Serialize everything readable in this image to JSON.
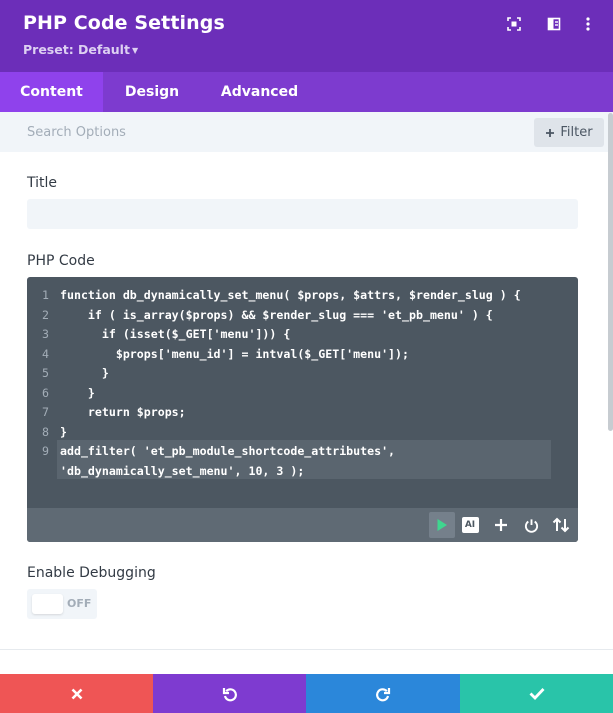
{
  "header": {
    "title": "PHP Code Settings",
    "preset": "Preset: Default",
    "icons": [
      "expand-icon",
      "split-view-icon",
      "more-options-icon"
    ],
    "background": "#6c2eb9"
  },
  "tabs": [
    {
      "label": "Content",
      "active": true
    },
    {
      "label": "Design",
      "active": false
    },
    {
      "label": "Advanced",
      "active": false
    }
  ],
  "search": {
    "placeholder": "Search Options",
    "value": "",
    "filter_label": "Filter"
  },
  "fields": {
    "title_label": "Title",
    "title_value": "",
    "code_label": "PHP Code",
    "debug_label": "Enable Debugging",
    "debug_state": "OFF"
  },
  "code": {
    "line_numbers": [
      "1",
      "2",
      "3",
      "4",
      "5",
      "6",
      "7",
      "8",
      "9"
    ],
    "lines": [
      "function db_dynamically_set_menu( $props, $attrs, $render_slug ) {",
      "    if ( is_array($props) && $render_slug === 'et_pb_menu' ) {",
      "      if (isset($_GET['menu'])) {",
      "        $props['menu_id'] = intval($_GET['menu']);",
      "      }",
      "    }",
      "    return $props;",
      "}",
      "add_filter( 'et_pb_module_shortcode_attributes',",
      "'db_dynamically_set_menu', 10, 3 );"
    ],
    "toolbar_icons": [
      "run-icon",
      "ai-icon",
      "add-icon",
      "power-icon",
      "sort-icon"
    ],
    "ai_text": "AI"
  },
  "footer": {
    "buttons": [
      {
        "name": "cancel",
        "color": "#ef5555"
      },
      {
        "name": "undo",
        "color": "#7e3bd0"
      },
      {
        "name": "redo",
        "color": "#2b87da"
      },
      {
        "name": "save",
        "color": "#29c4a9"
      }
    ]
  },
  "colors": {
    "tab_bar": "#7d3bcf",
    "active_tab": "#8f42ec",
    "code_bg": "#4c5761"
  }
}
